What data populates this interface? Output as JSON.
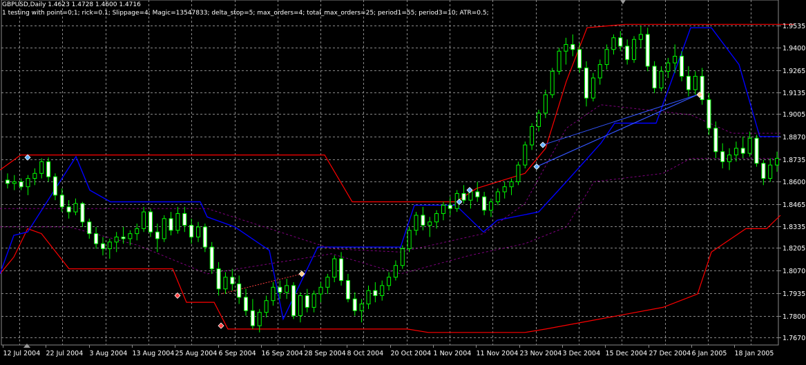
{
  "header": {
    "symbol_line": "GBPUSD,Daily  1.4623 1.4728 1.4600 1.4716",
    "ea_line": "1 testing with point=0;1; rick=0.1; Slippage=4; Magic=13547833; delta_stop=5; max_orders=4; total_max_orders=25; period1=55; period3=10; ATR=0.5;"
  },
  "colors": {
    "background": "#000000",
    "grid": "#8a8a8a",
    "bull_candle": "#ffffff",
    "bear_candle": "#00ff00",
    "channel_upper": "#ff0000",
    "channel_lower": "#0000ff",
    "trail": "#800080",
    "axis_text": "#ffffff"
  },
  "chart_data": {
    "type": "candlestick",
    "ylim": [
      1.7625,
      1.9595
    ],
    "y_ticks": [
      "1.9535",
      "1.9400",
      "1.9265",
      "1.9135",
      "1.9005",
      "1.8870",
      "1.8735",
      "1.8600",
      "1.8465",
      "1.8335",
      "1.8205",
      "1.8070",
      "1.7935",
      "1.7800",
      "1.7670"
    ],
    "x_ticks": [
      "12 Jul 2004",
      "22 Jul 2004",
      "3 Aug 2004",
      "13 Aug 2004",
      "25 Aug 2004",
      "6 Sep 2004",
      "16 Sep 2004",
      "28 Sep 2004",
      "8 Oct 2004",
      "20 Oct 2004",
      "1 Nov 2004",
      "11 Nov 2004",
      "23 Nov 2004",
      "3 Dec 2004",
      "15 Dec 2004",
      "27 Dec 2004",
      "6 Jan 2005",
      "18 Jan 2005"
    ],
    "candles": [
      [
        1.861,
        1.865,
        1.856,
        1.859
      ],
      [
        1.859,
        1.864,
        1.855,
        1.86
      ],
      [
        1.86,
        1.862,
        1.855,
        1.857
      ],
      [
        1.857,
        1.864,
        1.852,
        1.862
      ],
      [
        1.862,
        1.868,
        1.858,
        1.865
      ],
      [
        1.865,
        1.874,
        1.862,
        1.872
      ],
      [
        1.872,
        1.8745,
        1.86,
        1.863
      ],
      [
        1.863,
        1.865,
        1.849,
        1.852
      ],
      [
        1.852,
        1.856,
        1.842,
        1.845
      ],
      [
        1.845,
        1.849,
        1.838,
        1.842
      ],
      [
        1.842,
        1.85,
        1.84,
        1.847
      ],
      [
        1.847,
        1.848,
        1.833,
        1.836
      ],
      [
        1.836,
        1.838,
        1.826,
        1.829
      ],
      [
        1.829,
        1.833,
        1.82,
        1.823
      ],
      [
        1.823,
        1.827,
        1.816,
        1.82
      ],
      [
        1.82,
        1.826,
        1.814,
        1.824
      ],
      [
        1.824,
        1.83,
        1.818,
        1.827
      ],
      [
        1.827,
        1.833,
        1.823,
        1.826
      ],
      [
        1.826,
        1.831,
        1.822,
        1.829
      ],
      [
        1.829,
        1.835,
        1.825,
        1.832
      ],
      [
        1.832,
        1.845,
        1.83,
        1.842
      ],
      [
        1.842,
        1.844,
        1.827,
        1.83
      ],
      [
        1.83,
        1.835,
        1.818,
        1.826
      ],
      [
        1.826,
        1.84,
        1.824,
        1.838
      ],
      [
        1.838,
        1.842,
        1.828,
        1.831
      ],
      [
        1.831,
        1.845,
        1.829,
        1.841
      ],
      [
        1.841,
        1.845,
        1.83,
        1.834
      ],
      [
        1.834,
        1.838,
        1.823,
        1.827
      ],
      [
        1.827,
        1.836,
        1.824,
        1.833
      ],
      [
        1.833,
        1.835,
        1.818,
        1.821
      ],
      [
        1.821,
        1.824,
        1.805,
        1.808
      ],
      [
        1.808,
        1.812,
        1.792,
        1.796
      ],
      [
        1.796,
        1.806,
        1.793,
        1.803
      ],
      [
        1.803,
        1.808,
        1.795,
        1.799
      ],
      [
        1.799,
        1.804,
        1.787,
        1.791
      ],
      [
        1.791,
        1.796,
        1.78,
        1.783
      ],
      [
        1.783,
        1.79,
        1.772,
        1.774
      ],
      [
        1.774,
        1.784,
        1.77,
        1.782
      ],
      [
        1.782,
        1.792,
        1.779,
        1.789
      ],
      [
        1.789,
        1.8,
        1.786,
        1.797
      ],
      [
        1.797,
        1.801,
        1.79,
        1.794
      ],
      [
        1.794,
        1.802,
        1.79,
        1.798
      ],
      [
        1.798,
        1.8,
        1.778,
        1.78
      ],
      [
        1.78,
        1.794,
        1.776,
        1.792
      ],
      [
        1.792,
        1.796,
        1.782,
        1.785
      ],
      [
        1.785,
        1.795,
        1.782,
        1.793
      ],
      [
        1.793,
        1.8,
        1.788,
        1.797
      ],
      [
        1.797,
        1.805,
        1.793,
        1.803
      ],
      [
        1.803,
        1.816,
        1.8,
        1.814
      ],
      [
        1.814,
        1.818,
        1.798,
        1.801
      ],
      [
        1.801,
        1.805,
        1.788,
        1.79
      ],
      [
        1.79,
        1.794,
        1.78,
        1.783
      ],
      [
        1.783,
        1.79,
        1.776,
        1.787
      ],
      [
        1.787,
        1.798,
        1.784,
        1.795
      ],
      [
        1.795,
        1.8,
        1.788,
        1.792
      ],
      [
        1.792,
        1.801,
        1.789,
        1.798
      ],
      [
        1.798,
        1.806,
        1.795,
        1.803
      ],
      [
        1.803,
        1.813,
        1.801,
        1.81
      ],
      [
        1.81,
        1.822,
        1.808,
        1.82
      ],
      [
        1.82,
        1.833,
        1.818,
        1.831
      ],
      [
        1.831,
        1.842,
        1.828,
        1.84
      ],
      [
        1.84,
        1.845,
        1.831,
        1.834
      ],
      [
        1.834,
        1.839,
        1.827,
        1.836
      ],
      [
        1.836,
        1.843,
        1.832,
        1.841
      ],
      [
        1.841,
        1.848,
        1.837,
        1.846
      ],
      [
        1.846,
        1.851,
        1.84,
        1.844
      ],
      [
        1.844,
        1.855,
        1.842,
        1.853
      ],
      [
        1.853,
        1.858,
        1.847,
        1.849
      ],
      [
        1.849,
        1.856,
        1.844,
        1.854
      ],
      [
        1.854,
        1.86,
        1.848,
        1.851
      ],
      [
        1.851,
        1.854,
        1.84,
        1.843
      ],
      [
        1.843,
        1.85,
        1.839,
        1.848
      ],
      [
        1.848,
        1.856,
        1.846,
        1.854
      ],
      [
        1.854,
        1.86,
        1.85,
        1.857
      ],
      [
        1.857,
        1.862,
        1.852,
        1.86
      ],
      [
        1.86,
        1.872,
        1.858,
        1.87
      ],
      [
        1.87,
        1.884,
        1.868,
        1.882
      ],
      [
        1.882,
        1.895,
        1.879,
        1.893
      ],
      [
        1.893,
        1.903,
        1.89,
        1.901
      ],
      [
        1.901,
        1.915,
        1.898,
        1.912
      ],
      [
        1.912,
        1.928,
        1.91,
        1.926
      ],
      [
        1.926,
        1.94,
        1.924,
        1.938
      ],
      [
        1.938,
        1.946,
        1.93,
        1.942
      ],
      [
        1.942,
        1.948,
        1.935,
        1.939
      ],
      [
        1.939,
        1.943,
        1.925,
        1.928
      ],
      [
        1.928,
        1.932,
        1.905,
        1.91
      ],
      [
        1.91,
        1.925,
        1.908,
        1.922
      ],
      [
        1.922,
        1.933,
        1.918,
        1.93
      ],
      [
        1.93,
        1.942,
        1.927,
        1.939
      ],
      [
        1.939,
        1.948,
        1.936,
        1.946
      ],
      [
        1.946,
        1.95,
        1.938,
        1.941
      ],
      [
        1.941,
        1.945,
        1.93,
        1.933
      ],
      [
        1.933,
        1.947,
        1.931,
        1.945
      ],
      [
        1.945,
        1.953,
        1.94,
        1.948
      ],
      [
        1.948,
        1.952,
        1.926,
        1.929
      ],
      [
        1.929,
        1.932,
        1.913,
        1.916
      ],
      [
        1.916,
        1.929,
        1.914,
        1.926
      ],
      [
        1.926,
        1.934,
        1.922,
        1.931
      ],
      [
        1.931,
        1.942,
        1.925,
        1.935
      ],
      [
        1.935,
        1.938,
        1.92,
        1.923
      ],
      [
        1.923,
        1.929,
        1.911,
        1.915
      ],
      [
        1.915,
        1.926,
        1.912,
        1.923
      ],
      [
        1.923,
        1.928,
        1.906,
        1.909
      ],
      [
        1.909,
        1.913,
        1.888,
        1.892
      ],
      [
        1.892,
        1.896,
        1.874,
        1.878
      ],
      [
        1.878,
        1.883,
        1.868,
        1.872
      ],
      [
        1.872,
        1.88,
        1.867,
        1.876
      ],
      [
        1.876,
        1.884,
        1.872,
        1.88
      ],
      [
        1.88,
        1.887,
        1.874,
        1.877
      ],
      [
        1.877,
        1.89,
        1.875,
        1.886
      ],
      [
        1.886,
        1.888,
        1.869,
        1.871
      ],
      [
        1.871,
        1.873,
        1.858,
        1.862
      ],
      [
        1.862,
        1.874,
        1.86,
        1.87
      ],
      [
        1.87,
        1.878,
        1.866,
        1.874
      ]
    ],
    "lines": {
      "upper": [
        [
          0,
          1.867
        ],
        [
          30,
          1.876
        ],
        [
          440,
          1.876
        ],
        [
          470,
          1.876
        ],
        [
          510,
          1.848
        ],
        [
          660,
          1.848
        ],
        [
          690,
          1.856
        ],
        [
          760,
          1.865
        ],
        [
          790,
          1.88
        ],
        [
          820,
          1.92
        ],
        [
          850,
          1.952
        ],
        [
          905,
          1.954
        ],
        [
          1150,
          1.954
        ]
      ],
      "lower": [
        [
          0,
          1.805
        ],
        [
          20,
          1.815
        ],
        [
          40,
          1.832
        ],
        [
          60,
          1.829
        ],
        [
          100,
          1.808
        ],
        [
          250,
          1.808
        ],
        [
          270,
          1.788
        ],
        [
          310,
          1.788
        ],
        [
          330,
          1.772
        ],
        [
          590,
          1.772
        ],
        [
          620,
          1.77
        ],
        [
          760,
          1.77
        ],
        [
          790,
          1.772
        ],
        [
          960,
          1.785
        ],
        [
          1010,
          1.793
        ],
        [
          1030,
          1.818
        ],
        [
          1080,
          1.832
        ],
        [
          1110,
          1.832
        ],
        [
          1130,
          1.84
        ]
      ],
      "blue": [
        [
          0,
          1.805
        ],
        [
          20,
          1.828
        ],
        [
          40,
          1.83
        ],
        [
          110,
          1.875
        ],
        [
          130,
          1.855
        ],
        [
          160,
          1.848
        ],
        [
          290,
          1.848
        ],
        [
          300,
          1.839
        ],
        [
          340,
          1.833
        ],
        [
          390,
          1.819
        ],
        [
          410,
          1.778
        ],
        [
          460,
          1.821
        ],
        [
          580,
          1.821
        ],
        [
          600,
          1.846
        ],
        [
          660,
          1.846
        ],
        [
          700,
          1.83
        ],
        [
          720,
          1.837
        ],
        [
          780,
          1.842
        ],
        [
          820,
          1.86
        ],
        [
          870,
          1.883
        ],
        [
          890,
          1.895
        ],
        [
          950,
          1.895
        ],
        [
          1000,
          1.952
        ],
        [
          1030,
          1.952
        ],
        [
          1070,
          1.93
        ],
        [
          1100,
          1.887
        ],
        [
          1130,
          1.887
        ]
      ],
      "trail_upper": [
        [
          0,
          1.844
        ],
        [
          100,
          1.844
        ],
        [
          300,
          1.844
        ],
        [
          480,
          1.82
        ],
        [
          580,
          1.818
        ],
        [
          700,
          1.829
        ],
        [
          760,
          1.847
        ],
        [
          820,
          1.892
        ],
        [
          870,
          1.906
        ],
        [
          1000,
          1.9
        ],
        [
          1060,
          1.889
        ],
        [
          1130,
          1.889
        ]
      ],
      "trail_lower": [
        [
          0,
          1.833
        ],
        [
          100,
          1.833
        ],
        [
          200,
          1.822
        ],
        [
          300,
          1.805
        ],
        [
          480,
          1.817
        ],
        [
          580,
          1.805
        ],
        [
          680,
          1.816
        ],
        [
          760,
          1.823
        ],
        [
          820,
          1.833
        ],
        [
          860,
          1.86
        ],
        [
          960,
          1.865
        ],
        [
          1000,
          1.874
        ],
        [
          1130,
          1.874
        ]
      ]
    },
    "arrows": [
      {
        "x": 40,
        "y": 1.8745,
        "color": "#5fb0ff"
      },
      {
        "x": 257,
        "y": 1.792,
        "color": "#ff4040"
      },
      {
        "x": 320,
        "y": 1.774,
        "color": "#ff4040"
      },
      {
        "x": 437,
        "y": 1.805,
        "color": "#ffcc88"
      },
      {
        "x": 665,
        "y": 1.848,
        "color": "#5fb0ff"
      },
      {
        "x": 680,
        "y": 1.855,
        "color": "#5fb0ff"
      },
      {
        "x": 777,
        "y": 1.869,
        "color": "#5fb0ff"
      },
      {
        "x": 786,
        "y": 1.882,
        "color": "#5fb0ff"
      },
      {
        "x": 1013,
        "y": 1.912,
        "color": "#ffcc88"
      }
    ]
  }
}
